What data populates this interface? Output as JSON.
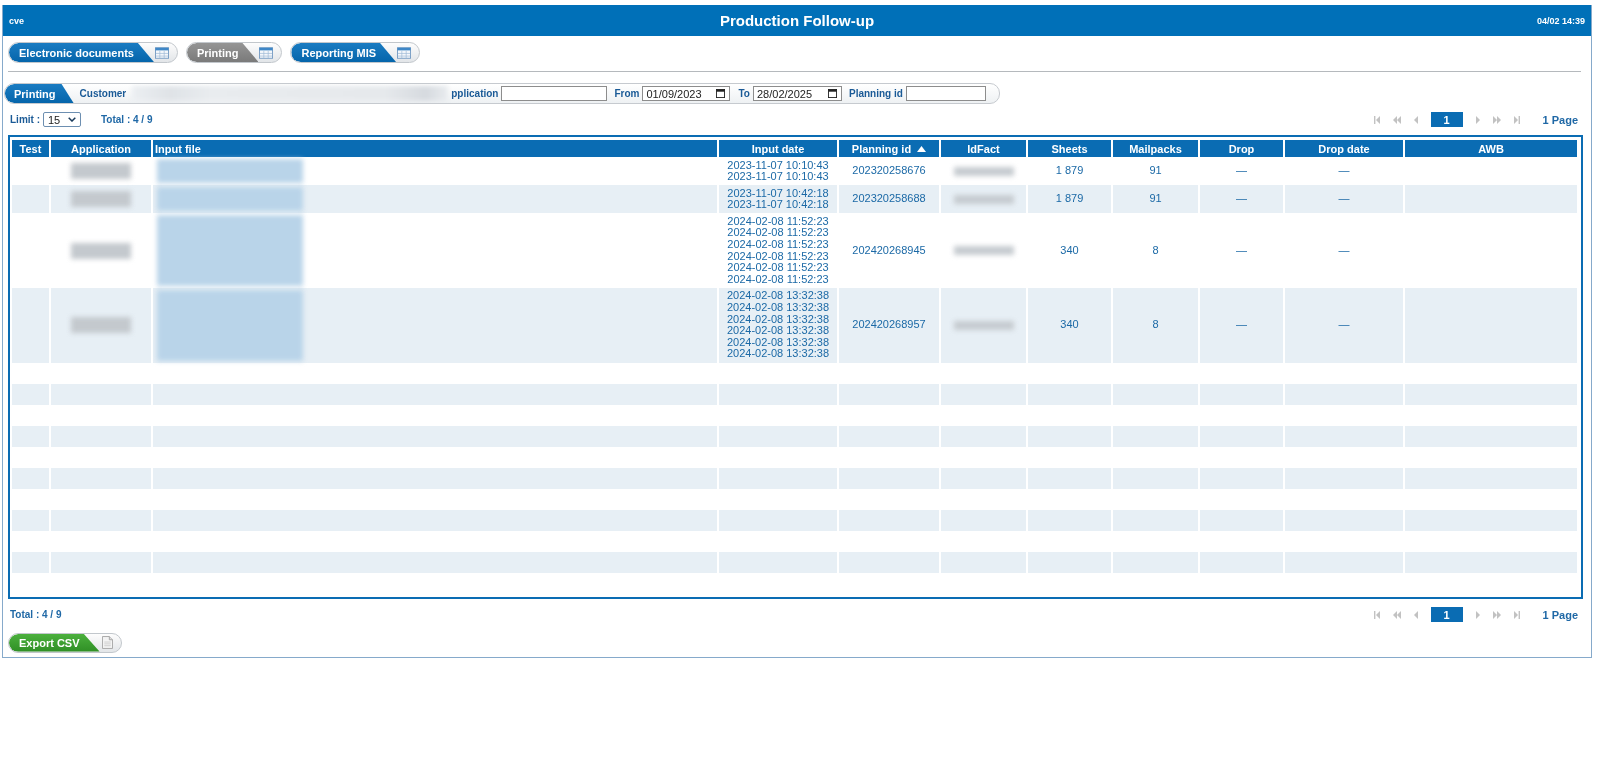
{
  "window": {
    "user": "cve",
    "title": "Production Follow-up",
    "datetime": "04/02 14:39"
  },
  "modules": [
    {
      "label": "Electronic documents",
      "selected": false
    },
    {
      "label": "Printing",
      "selected": true
    },
    {
      "label": "Reporting MIS",
      "selected": false
    }
  ],
  "filters": {
    "section": "Printing",
    "customer": {
      "label": "Customer",
      "redacted": true
    },
    "application": {
      "label": "pplication"
    },
    "from": {
      "label": "From",
      "value": "01/09/2023"
    },
    "to": {
      "label": "To",
      "value": "28/02/2025"
    },
    "planning_id": {
      "label": "Planning id"
    }
  },
  "toolbar": {
    "limit_label": "Limit :",
    "limit": "15",
    "total": "Total : 4 / 9",
    "pagination": {
      "controls": [
        {
          "kind": "first",
          "disabled": true
        },
        {
          "kind": "rewind",
          "disabled": true
        },
        {
          "kind": "previous",
          "disabled": true
        },
        {
          "kind": "page",
          "label": "1",
          "selected": true
        },
        {
          "kind": "next",
          "disabled": true
        },
        {
          "kind": "forward",
          "disabled": true
        },
        {
          "kind": "last",
          "disabled": true
        }
      ],
      "summary": "1 Page"
    }
  },
  "table": {
    "columns": [
      {
        "label": "Test"
      },
      {
        "label": "Application",
        "redacted": true
      },
      {
        "label": "Input file",
        "redacted": true
      },
      {
        "label": "Input date"
      },
      {
        "label": "Planning id",
        "sorted_ascending": true
      },
      {
        "label": "IdFact",
        "redacted": true
      },
      {
        "label": "Sheets"
      },
      {
        "label": "Mailpacks"
      },
      {
        "label": "Drop"
      },
      {
        "label": "Drop date"
      },
      {
        "label": "AWB"
      }
    ],
    "rows": [
      {
        "cells": [
          null,
          null,
          null,
          [
            "2023-11-07 10:10:43",
            "2023-11-07 10:10:43"
          ],
          "202320258676",
          null,
          "1 879",
          "91",
          "—",
          "—",
          null
        ]
      },
      {
        "cells": [
          null,
          null,
          null,
          [
            "2023-11-07 10:42:18",
            "2023-11-07 10:42:18"
          ],
          "202320258688",
          null,
          "1 879",
          "91",
          "—",
          "—",
          null
        ]
      },
      {
        "cells": [
          null,
          null,
          null,
          [
            "2024-02-08 11:52:23",
            "2024-02-08 11:52:23",
            "2024-02-08 11:52:23",
            "2024-02-08 11:52:23",
            "2024-02-08 11:52:23",
            "2024-02-08 11:52:23"
          ],
          "202420268945",
          null,
          "340",
          "8",
          "—",
          "—",
          null
        ]
      },
      {
        "cells": [
          null,
          null,
          null,
          [
            "2024-02-08 13:32:38",
            "2024-02-08 13:32:38",
            "2024-02-08 13:32:38",
            "2024-02-08 13:32:38",
            "2024-02-08 13:32:38",
            "2024-02-08 13:32:38"
          ],
          "202420268957",
          null,
          "340",
          "8",
          "—",
          "—",
          null
        ]
      }
    ]
  },
  "footer": {
    "total": "Total : 4 / 9",
    "pagination": {
      "controls": [
        {
          "kind": "first",
          "disabled": true
        },
        {
          "kind": "rewind",
          "disabled": true
        },
        {
          "kind": "previous",
          "disabled": true
        },
        {
          "kind": "page",
          "label": "1",
          "selected": true
        },
        {
          "kind": "next",
          "disabled": true
        },
        {
          "kind": "forward",
          "disabled": true
        },
        {
          "kind": "last",
          "disabled": true
        }
      ],
      "summary": "1 Page"
    },
    "export_button": "Export CSV"
  }
}
